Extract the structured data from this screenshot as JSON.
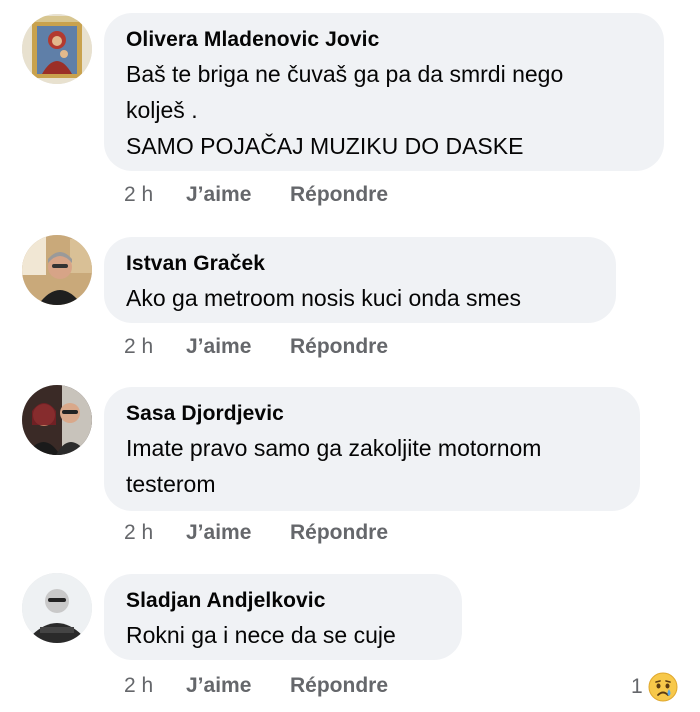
{
  "comments": [
    {
      "author": "Olivera Mladenovic Jovic",
      "text": "Baš te briga ne čuvaš ga pa da smrdi nego\nkolješ .\nSAMO POJAČAJ MUZIKU DO DASKE",
      "time": "2 h",
      "like_label": "J’aime",
      "reply_label": "Répondre",
      "avatar_icon": "icon-painting-avatar"
    },
    {
      "author": "Istvan Graček",
      "text": "Ako ga metroom nosis kuci onda smes",
      "time": "2 h",
      "like_label": "J’aime",
      "reply_label": "Répondre",
      "avatar_icon": "man-photo-avatar"
    },
    {
      "author": "Sasa Djordjevic",
      "text": "Imate pravo samo ga zakoljite motornom\ntesterom",
      "time": "2 h",
      "like_label": "J’aime",
      "reply_label": "Répondre",
      "avatar_icon": "couple-photo-avatar"
    },
    {
      "author": "Sladjan Andjelkovic",
      "text": "Rokni ga i nece da se cuje",
      "time": "2 h",
      "like_label": "J’aime",
      "reply_label": "Répondre",
      "avatar_icon": "man-photo-avatar",
      "reaction": {
        "count": "1",
        "emoji": "😢",
        "icon": "sad-reaction-icon"
      }
    }
  ],
  "colors": {
    "bubble": "#f0f2f5",
    "meta_text": "#65676b",
    "text": "#050505"
  }
}
